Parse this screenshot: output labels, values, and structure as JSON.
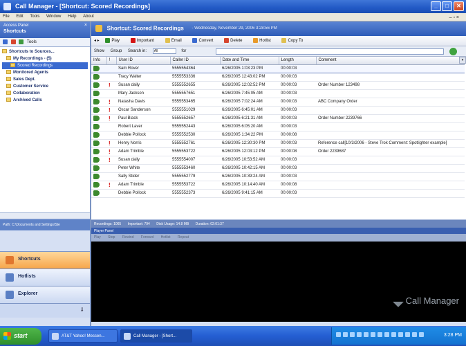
{
  "window": {
    "title": "Call Manager - [Shortcut: Scored Recordings]",
    "menu": [
      "File",
      "Edit",
      "Tools",
      "Window",
      "Help",
      "About"
    ]
  },
  "left_panel": {
    "title": "Access Panel",
    "subtitle": "Shortcuts",
    "tools_label": "Tools",
    "tree": [
      {
        "label": "Shortcuts to Sources...",
        "level": 0
      },
      {
        "label": "My Recordings - (5)",
        "level": 1
      },
      {
        "label": "Scored Recordings",
        "level": 2,
        "selected": true
      },
      {
        "label": "Monitored Agents",
        "level": 1
      },
      {
        "label": "Sales Dept.",
        "level": 1
      },
      {
        "label": "Customer Service",
        "level": 1
      },
      {
        "label": "Collaboration",
        "level": 1
      },
      {
        "label": "Archived Calls",
        "level": 1
      }
    ],
    "path": "Path: C:\\Documents and Settings\\Ste",
    "nav": [
      {
        "label": "Shortcuts",
        "active": true
      },
      {
        "label": "Hotlists",
        "active": false
      },
      {
        "label": "Explorer",
        "active": false
      }
    ]
  },
  "main": {
    "header_title": "Shortcut: Scored Recordings",
    "header_date": "- Wednesday, November 29, 2006 3:28:56 PM",
    "toolbar": [
      "Play",
      "Important",
      "Email",
      "Convert",
      "Delete",
      "Hotlist",
      "Copy To"
    ],
    "filter": {
      "show": "Show",
      "group": "Group",
      "search_in": "Search in:",
      "search_value": "All",
      "for": "for"
    },
    "columns": [
      "Info",
      "!",
      "User ID",
      "Caller ID",
      "Date and Time",
      "Length",
      "Comment"
    ],
    "rows": [
      {
        "flag": "",
        "user": "Sam Rover",
        "caller": "5555554364",
        "datetime": "6/26/2005 1:03:23 PM",
        "length": "00:00:03",
        "comment": ""
      },
      {
        "flag": "",
        "user": "Tracy Walter",
        "caller": "5555553336",
        "datetime": "6/26/2005 12:43:02 PM",
        "length": "00:00:03",
        "comment": ""
      },
      {
        "flag": "!",
        "user": "Susan daily",
        "caller": "5555552655",
        "datetime": "6/26/2005 12:02:52 PM",
        "length": "00:00:03",
        "comment": "Order Number 123498"
      },
      {
        "flag": "",
        "user": "Mary Jackson",
        "caller": "5555557651",
        "datetime": "6/26/2005 7:45:05 AM",
        "length": "00:00:03",
        "comment": ""
      },
      {
        "flag": "!",
        "user": "Natasha Davis",
        "caller": "5555553465",
        "datetime": "6/26/2005 7:02:24 AM",
        "length": "00:00:03",
        "comment": "ABC Company Order"
      },
      {
        "flag": "!",
        "user": "Oscar Sanderson",
        "caller": "5555551029",
        "datetime": "6/26/2005 6:45:01 AM",
        "length": "00:00:03",
        "comment": ""
      },
      {
        "flag": "!",
        "user": "Paul Black",
        "caller": "5555552657",
        "datetime": "6/26/2005 6:21:31 AM",
        "length": "00:00:03",
        "comment": "Order Number 2239766"
      },
      {
        "flag": "",
        "user": "Robert Laver",
        "caller": "5555552443",
        "datetime": "6/26/2005 6:05:20 AM",
        "length": "00:00:03",
        "comment": ""
      },
      {
        "flag": "",
        "user": "Debbie Pollock",
        "caller": "5555552530",
        "datetime": "6/26/2005 1:34:22 PM",
        "length": "00:00:08",
        "comment": ""
      },
      {
        "flag": "!",
        "user": "Henry Norris",
        "caller": "5555552761",
        "datetime": "6/26/2005 12:30:30 PM",
        "length": "00:00:03",
        "comment": "Reference call[10/3/2006 - Steve Trok Comment: Spotlighter example]"
      },
      {
        "flag": "!",
        "user": "Adam Trimble",
        "caller": "5555553722",
        "datetime": "6/26/2005 12:03:12 PM",
        "length": "00:00:08",
        "comment": "Order 2239687"
      },
      {
        "flag": "!",
        "user": "Susan daily",
        "caller": "5555554007",
        "datetime": "6/26/2005 10:53:52 AM",
        "length": "00:00:03",
        "comment": ""
      },
      {
        "flag": "",
        "user": "Peter White",
        "caller": "5555553460",
        "datetime": "6/26/2005 10:42:15 AM",
        "length": "00:00:03",
        "comment": ""
      },
      {
        "flag": "",
        "user": "Sally Stider",
        "caller": "5555552779",
        "datetime": "6/26/2005 10:39:24 AM",
        "length": "00:00:03",
        "comment": ""
      },
      {
        "flag": "!",
        "user": "Adam Trimble",
        "caller": "5555553722",
        "datetime": "6/26/2005 10:14:40 AM",
        "length": "00:00:08",
        "comment": ""
      },
      {
        "flag": "",
        "user": "Debbie Pollock",
        "caller": "5555552373",
        "datetime": "6/26/2005 9:41:15 AM",
        "length": "00:00:03",
        "comment": ""
      }
    ],
    "status": [
      "Recordings: 1065",
      "Important: 794",
      "Disk Usage: 14.8 MB",
      "Duration: 02:01:37"
    ],
    "player_title": "Player Panel",
    "player_tools": [
      "Play",
      "Stop",
      "Rewind",
      "Forward",
      "Hotlist",
      "Repeat"
    ],
    "brand": "Call Manager"
  },
  "taskbar": {
    "start": "start",
    "tasks": [
      {
        "label": "AT&T Yahoo! Messen...",
        "active": false
      },
      {
        "label": "Call Manager - [Short...",
        "active": true
      }
    ],
    "clock": "3:28 PM"
  },
  "colors": {
    "title_blue": "#2259c5",
    "nav_active": "#f6a64b",
    "flag_red": "#d41414"
  }
}
